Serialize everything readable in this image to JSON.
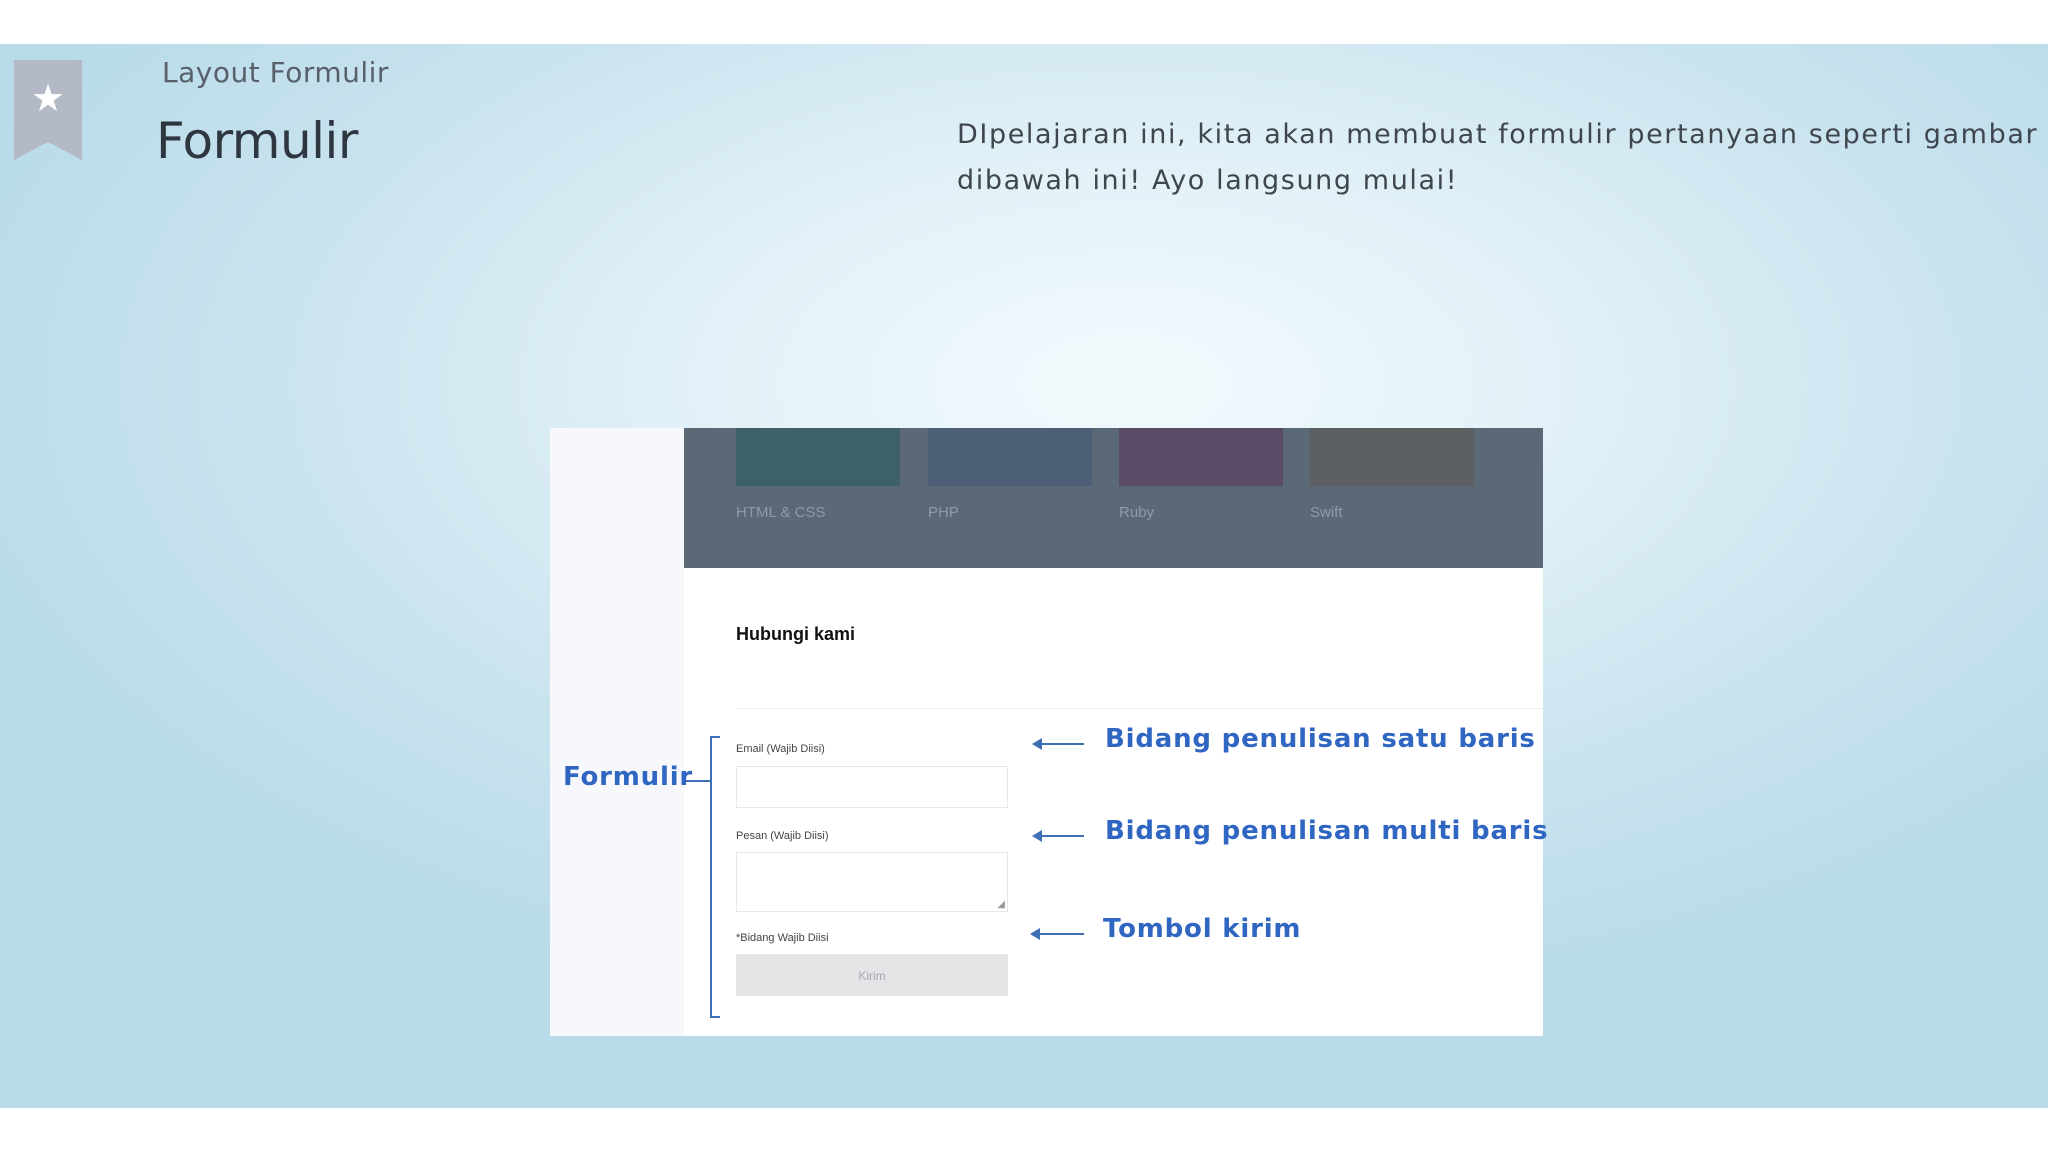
{
  "slide": {
    "subtitle": "Layout Formulir",
    "title": "Formulir",
    "intro": "DIpelajaran ini, kita akan membuat formulir pertanyaan seperti gambar dibawah ini! Ayo langsung mulai!",
    "bookmark_icon": "star-icon"
  },
  "languages": [
    {
      "label": "HTML & CSS",
      "color": "#3e6167"
    },
    {
      "label": "PHP",
      "color": "#4e5f78"
    },
    {
      "label": "Ruby",
      "color": "#5a4b66"
    },
    {
      "label": "Swift",
      "color": "#5d6063"
    }
  ],
  "form": {
    "heading": "Hubungi kami",
    "email_label": "Email (Wajib Diisi)",
    "message_label": "Pesan (Wajib Diisi)",
    "required_note": "*Bidang Wajib Diisi",
    "submit_label": "Kirim"
  },
  "annotations": {
    "form_label": "Formulir",
    "single_line": "Bidang penulisan satu baris",
    "multi_line": "Bidang penulisan multi baris",
    "submit": "Tombol kirim",
    "color": "#2f66c2"
  }
}
